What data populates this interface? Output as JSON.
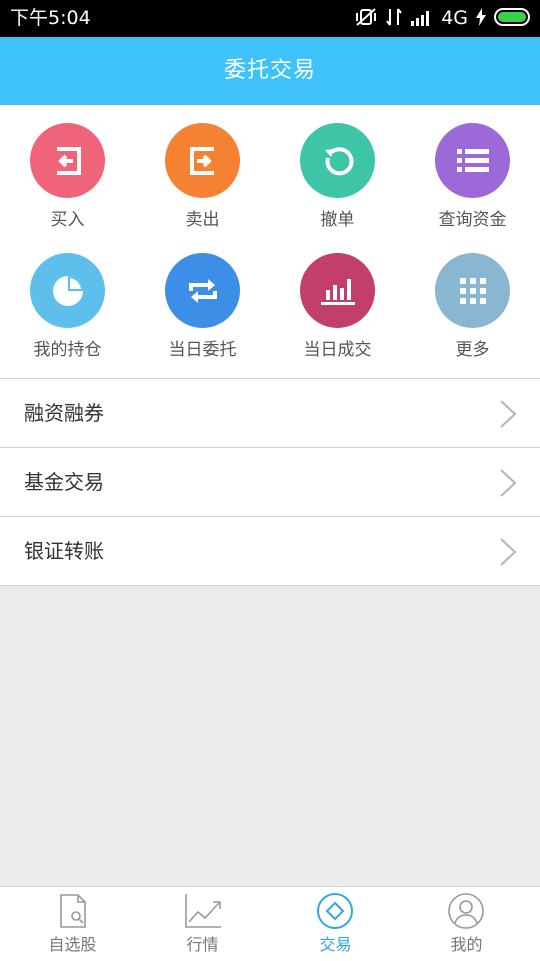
{
  "status_bar": {
    "time": "下午5:04",
    "network": "4G"
  },
  "header": {
    "title": "委托交易"
  },
  "actions": [
    {
      "label": "买入",
      "icon": "buy-login-icon",
      "color": "#f0647a"
    },
    {
      "label": "卖出",
      "icon": "sell-logout-icon",
      "color": "#f58232"
    },
    {
      "label": "撤单",
      "icon": "cancel-refresh-icon",
      "color": "#3ec4a7"
    },
    {
      "label": "查询资金",
      "icon": "funds-list-icon",
      "color": "#9c69d8"
    },
    {
      "label": "我的持仓",
      "icon": "holdings-pie-icon",
      "color": "#5fbfec"
    },
    {
      "label": "当日委托",
      "icon": "today-orders-repeat-icon",
      "color": "#3c8ee6"
    },
    {
      "label": "当日成交",
      "icon": "today-deals-bar-icon",
      "color": "#c33f6b"
    },
    {
      "label": "更多",
      "icon": "more-grid-icon",
      "color": "#89b6d0"
    }
  ],
  "menu": [
    {
      "label": "融资融券"
    },
    {
      "label": "基金交易"
    },
    {
      "label": "银证转账"
    }
  ],
  "bottom_nav": [
    {
      "label": "自选股",
      "icon": "watchlist-doc-icon",
      "active": false
    },
    {
      "label": "行情",
      "icon": "market-chart-icon",
      "active": false
    },
    {
      "label": "交易",
      "icon": "trade-diamond-icon",
      "active": true
    },
    {
      "label": "我的",
      "icon": "profile-person-icon",
      "active": false
    }
  ],
  "colors": {
    "header": "#3ec2f7",
    "active_nav": "#2fa8e0"
  }
}
